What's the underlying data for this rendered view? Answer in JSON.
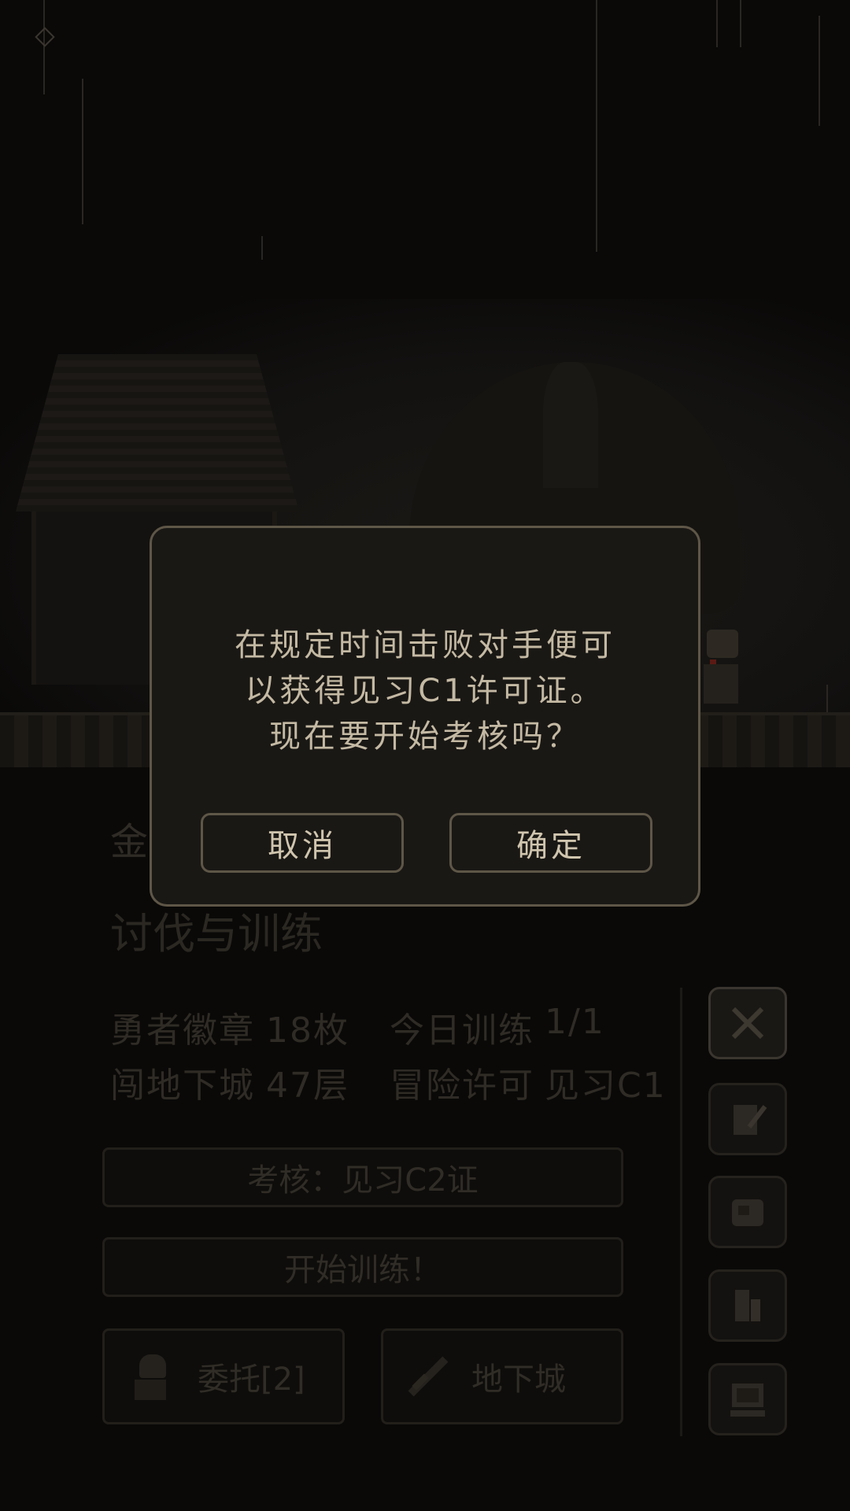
{
  "dialog": {
    "message_lines": [
      "在规定时间击败对手便可",
      "以获得见习C1许可证。",
      "现在要开始考核吗？"
    ],
    "cancel_label": "取消",
    "confirm_label": "确定"
  },
  "background_ui": {
    "section_partial": "金",
    "section_title": "讨伐与训练",
    "stats": {
      "badge_label": "勇者徽章",
      "badge_value": "18枚",
      "training_label": "今日训练",
      "training_value": "1/1",
      "dungeon_label": "闯地下城",
      "dungeon_value": "47层",
      "license_label": "冒险许可",
      "license_value": "见习C1"
    },
    "exam_button": "考核：见习C2证",
    "train_button": "开始训练！",
    "commission_button": "委托[2]",
    "dungeon_button": "地下城"
  },
  "side_icons": [
    "crossed-swords-icon",
    "quill-paper-icon",
    "scroll-map-icon",
    "bookshelf-icon",
    "computer-icon"
  ],
  "colors": {
    "dialog_bg": "#1a1815",
    "dialog_border": "#5e5647",
    "dialog_text": "#c4b9a3",
    "dim_text": "#2f2b25"
  }
}
